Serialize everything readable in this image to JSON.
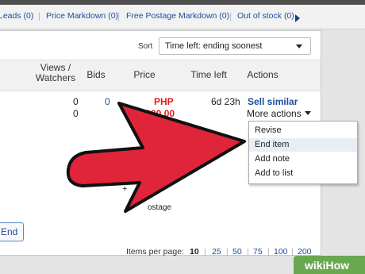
{
  "filters": [
    {
      "label": "Leads (0)"
    },
    {
      "label": "Price Markdown (0)"
    },
    {
      "label": "Free Postage Markdown (0)"
    },
    {
      "label": "Out of stock (0)"
    }
  ],
  "sort": {
    "label": "Sort",
    "value": "Time left: ending soonest"
  },
  "columns": {
    "views_watchers": "Views / Watchers",
    "bids": "Bids",
    "price": "Price",
    "time_left": "Time left",
    "actions": "Actions"
  },
  "listing": {
    "views": "0",
    "watchers": "0",
    "bids": "0",
    "price_currency": "PHP",
    "price_amount": ",000.00",
    "time_left": "6d 23h",
    "primary_action": "Sell similar",
    "more_actions": "More actions",
    "postage_text": "ostage",
    "plus_text": "+"
  },
  "more_actions_menu": [
    {
      "label": "Revise"
    },
    {
      "label": "End item"
    },
    {
      "label": "Add note"
    },
    {
      "label": "Add to list"
    }
  ],
  "end_button": "End",
  "pagination": {
    "label": "Items per page:",
    "current": "10",
    "options": [
      "25",
      "50",
      "75",
      "100",
      "200"
    ]
  },
  "watermark": "wikiHow",
  "colors": {
    "arrow": "#e0243a",
    "link": "#1a4d9c",
    "price": "#e01b1b"
  }
}
